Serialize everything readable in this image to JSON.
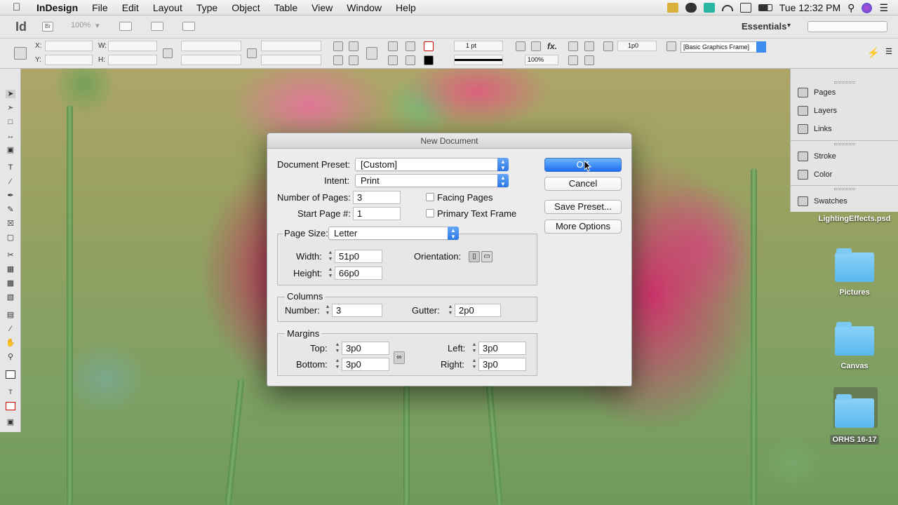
{
  "menubar": {
    "app_name": "InDesign",
    "items": [
      "File",
      "Edit",
      "Layout",
      "Type",
      "Object",
      "Table",
      "View",
      "Window",
      "Help"
    ],
    "clock": "Tue 12:32 PM"
  },
  "appbar": {
    "logo": "Id",
    "bridge": "Br",
    "zoom": "100%",
    "workspace": "Essentials"
  },
  "control_panel": {
    "x_label": "X:",
    "y_label": "Y:",
    "w_label": "W:",
    "h_label": "H:",
    "stroke_weight": "1 pt",
    "scale": "100%",
    "offset": "1p0",
    "frame_style": "[Basic Graphics Frame]"
  },
  "panels": {
    "items": [
      "Pages",
      "Layers",
      "Links",
      "Stroke",
      "Color",
      "Swatches"
    ]
  },
  "desktop": {
    "items": [
      "LightingEffects.psd",
      "Pictures",
      "Canvas",
      "ORHS 16-17"
    ]
  },
  "dialog": {
    "title": "New Document",
    "document_preset_label": "Document Preset:",
    "document_preset_value": "[Custom]",
    "intent_label": "Intent:",
    "intent_value": "Print",
    "num_pages_label": "Number of Pages:",
    "num_pages_value": "3",
    "start_page_label": "Start Page #:",
    "start_page_value": "1",
    "facing_pages_label": "Facing Pages",
    "primary_text_frame_label": "Primary Text Frame",
    "page_size_label": "Page Size:",
    "page_size_value": "Letter",
    "width_label": "Width:",
    "width_value": "51p0",
    "height_label": "Height:",
    "height_value": "66p0",
    "orientation_label": "Orientation:",
    "columns_title": "Columns",
    "columns_number_label": "Number:",
    "columns_number_value": "3",
    "gutter_label": "Gutter:",
    "gutter_value": "2p0",
    "margins_title": "Margins",
    "top_label": "Top:",
    "top_value": "3p0",
    "bottom_label": "Bottom:",
    "bottom_value": "3p0",
    "left_label": "Left:",
    "left_value": "3p0",
    "right_label": "Right:",
    "right_value": "3p0",
    "ok_label": "OK",
    "cancel_label": "Cancel",
    "save_preset_label": "Save Preset...",
    "more_options_label": "More Options"
  }
}
